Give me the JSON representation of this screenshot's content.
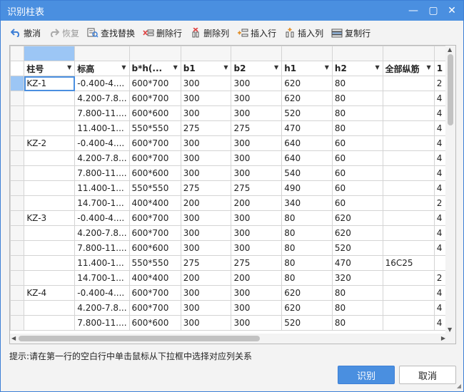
{
  "window": {
    "title": "识别柱表"
  },
  "toolbar": {
    "undo": "撤消",
    "redo": "恢复",
    "find_replace": "查找替换",
    "delete_row": "删除行",
    "delete_col": "删除列",
    "insert_row": "插入行",
    "insert_col": "插入列",
    "copy_row": "复制行"
  },
  "table": {
    "headers": [
      "柱号",
      "标高",
      "b*h(...",
      "b1",
      "b2",
      "h1",
      "h2",
      "全部纵筋",
      "1"
    ],
    "rows": [
      [
        "KZ-1",
        "-0.400-4....",
        "600*700",
        "300",
        "300",
        "620",
        "80",
        "",
        "2"
      ],
      [
        "",
        "4.200-7.8...",
        "600*700",
        "300",
        "300",
        "620",
        "80",
        "",
        "4"
      ],
      [
        "",
        "7.800-11....",
        "600*600",
        "300",
        "300",
        "520",
        "80",
        "",
        "4"
      ],
      [
        "",
        "11.400-1...",
        "550*550",
        "275",
        "275",
        "470",
        "80",
        "",
        "4"
      ],
      [
        "KZ-2",
        "-0.400-4....",
        "600*700",
        "300",
        "300",
        "640",
        "60",
        "",
        "4"
      ],
      [
        "",
        "4.200-7.8...",
        "600*700",
        "300",
        "300",
        "640",
        "60",
        "",
        "4"
      ],
      [
        "",
        "7.800-11....",
        "600*600",
        "300",
        "300",
        "540",
        "60",
        "",
        "4"
      ],
      [
        "",
        "11.400-1...",
        "550*550",
        "275",
        "275",
        "490",
        "60",
        "",
        "4"
      ],
      [
        "",
        "14.700-1...",
        "400*400",
        "200",
        "200",
        "340",
        "60",
        "",
        "2"
      ],
      [
        "KZ-3",
        "-0.400-4....",
        "600*700",
        "300",
        "300",
        "80",
        "620",
        "",
        "4"
      ],
      [
        "",
        "4.200-7.8...",
        "600*700",
        "300",
        "300",
        "80",
        "620",
        "",
        "4"
      ],
      [
        "",
        "7.800-11....",
        "600*600",
        "300",
        "300",
        "80",
        "520",
        "",
        "4"
      ],
      [
        "",
        "11.400-1...",
        "550*550",
        "275",
        "275",
        "80",
        "470",
        "16C25",
        ""
      ],
      [
        "",
        "14.700-1...",
        "400*400",
        "200",
        "200",
        "80",
        "320",
        "",
        "2"
      ],
      [
        "KZ-4",
        "-0.400-4....",
        "600*700",
        "300",
        "300",
        "620",
        "80",
        "",
        "4"
      ],
      [
        "",
        "4.200-7.8...",
        "600*700",
        "300",
        "300",
        "620",
        "80",
        "",
        "4"
      ],
      [
        "",
        "7.800-11....",
        "600*600",
        "300",
        "300",
        "520",
        "80",
        "",
        "4"
      ]
    ]
  },
  "hint": "提示:请在第一行的空白行中单击鼠标从下拉框中选择对应列关系",
  "buttons": {
    "ok": "识别",
    "cancel": "取消"
  },
  "colors": {
    "accent": "#4a8fe0",
    "selection": "#9cc6f5"
  }
}
